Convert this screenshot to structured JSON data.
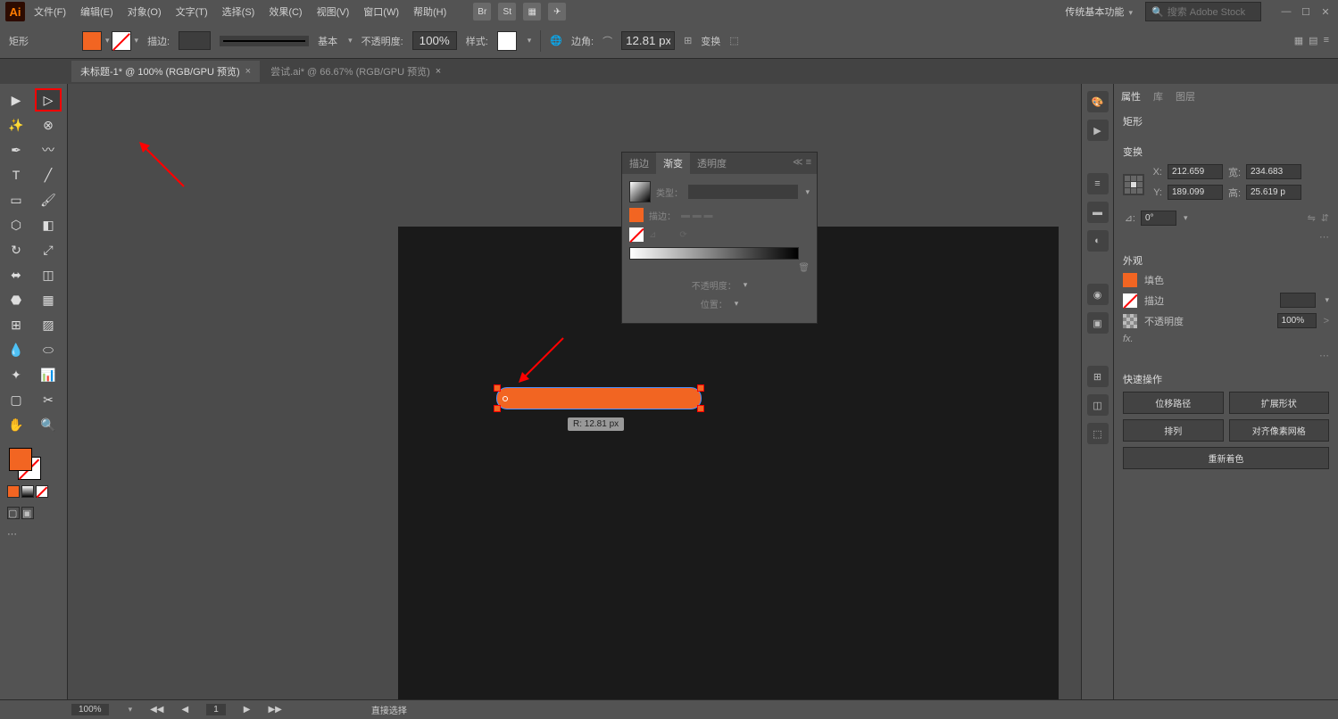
{
  "app_logo": "Ai",
  "menu": {
    "file": "文件(F)",
    "edit": "编辑(E)",
    "object": "对象(O)",
    "text": "文字(T)",
    "select": "选择(S)",
    "effect": "效果(C)",
    "view": "视图(V)",
    "window": "窗口(W)",
    "help": "帮助(H)"
  },
  "top_icons": {
    "br": "Br",
    "st": "St"
  },
  "workspace": "传统基本功能",
  "search_placeholder": "搜索 Adobe Stock",
  "control": {
    "shape_label": "矩形",
    "stroke_label": "描边:",
    "basic_label": "基本",
    "opacity_label": "不透明度:",
    "opacity_value": "100%",
    "style_label": "样式:",
    "corner_label": "边角:",
    "corner_value": "12.81 px",
    "transform_label": "变换"
  },
  "tabs": {
    "tab1": "未标题-1* @ 100% (RGB/GPU 预览)",
    "tab2": "尝试.ai* @ 66.67% (RGB/GPU 预览)"
  },
  "tooltip": "R: 12.81 px",
  "gradient_panel": {
    "tab_stroke": "描边",
    "tab_gradient": "渐变",
    "tab_transparency": "透明度",
    "type_label": "类型：",
    "stroke_btn": "描边：",
    "opacity_label": "不透明度：",
    "position_label": "位置："
  },
  "props": {
    "tab_attr": "属性",
    "tab_lib": "库",
    "tab_layers": "图层",
    "shape_name": "矩形",
    "transform_title": "变换",
    "x_label": "X:",
    "x_val": "212.659",
    "y_label": "Y:",
    "y_val": "189.099",
    "w_label": "宽:",
    "w_val": "234.683",
    "h_label": "高:",
    "h_val": "25.619 p",
    "angle_label": "⊿:",
    "angle_val": "0°",
    "appearance_title": "外观",
    "fill_label": "填色",
    "stroke_label": "描边",
    "opacity_label": "不透明度",
    "opacity_val": "100%",
    "fx_label": "fx.",
    "quick_title": "快速操作",
    "btn_offset": "位移路径",
    "btn_expand": "扩展形状",
    "btn_arrange": "排列",
    "btn_pixel": "对齐像素网格",
    "btn_recolor": "重新着色"
  },
  "status": {
    "zoom": "100%",
    "page": "1",
    "tool": "直接选择"
  }
}
